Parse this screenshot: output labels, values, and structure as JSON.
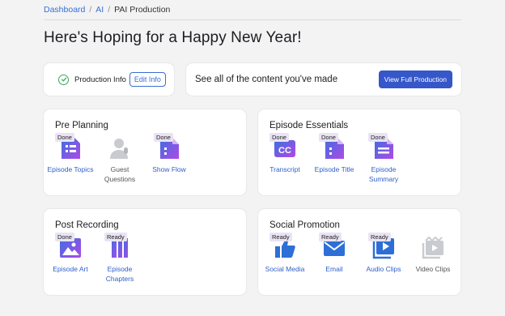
{
  "breadcrumb": {
    "items": [
      "Dashboard",
      "AI",
      "PAI Production"
    ],
    "separator": "/"
  },
  "page_title": "Here's Hoping for a Happy New Year!",
  "production_info": {
    "label": "Production Info",
    "edit_label": "Edit Info",
    "status_color": "#3aa655"
  },
  "content_summary": {
    "text": "See all of the content you've made",
    "button_label": "View Full Production",
    "button_color": "#3557c9"
  },
  "sections": {
    "pre_planning": {
      "title": "Pre Planning",
      "tiles": [
        {
          "label": "Episode Topics",
          "badge": "Done",
          "icon": "list-doc-icon"
        },
        {
          "label": "Guest Questions",
          "badge": "",
          "icon": "mic-user-icon"
        },
        {
          "label": "Show Flow",
          "badge": "Done",
          "icon": "doc-icon"
        }
      ]
    },
    "episode_essentials": {
      "title": "Episode Essentials",
      "tiles": [
        {
          "label": "Transcript",
          "badge": "Done",
          "icon": "caption-icon"
        },
        {
          "label": "Episode Title",
          "badge": "Done",
          "icon": "doc-icon"
        },
        {
          "label": "Episode Summary",
          "badge": "Done",
          "icon": "summary-doc-icon"
        }
      ]
    },
    "post_recording": {
      "title": "Post Recording",
      "tiles": [
        {
          "label": "Episode Art",
          "badge": "Done",
          "icon": "image-icon"
        },
        {
          "label": "Episode Chapters",
          "badge": "Ready",
          "icon": "chapters-icon"
        }
      ]
    },
    "social_promotion": {
      "title": "Social Promotion",
      "tiles": [
        {
          "label": "Social Media",
          "badge": "Ready",
          "icon": "thumbs-up-icon"
        },
        {
          "label": "Email",
          "badge": "Ready",
          "icon": "email-icon"
        },
        {
          "label": "Audio Clips",
          "badge": "Ready",
          "icon": "audio-clip-icon"
        },
        {
          "label": "Video Clips",
          "badge": "",
          "icon": "video-clip-icon"
        }
      ]
    }
  },
  "colors": {
    "link": "#2f5fc8",
    "icon_gradient_start": "#3b6fe0",
    "icon_gradient_end": "#b049e6",
    "icon_blue": "#2d6fd6",
    "icon_disabled": "#c9cbd0"
  }
}
